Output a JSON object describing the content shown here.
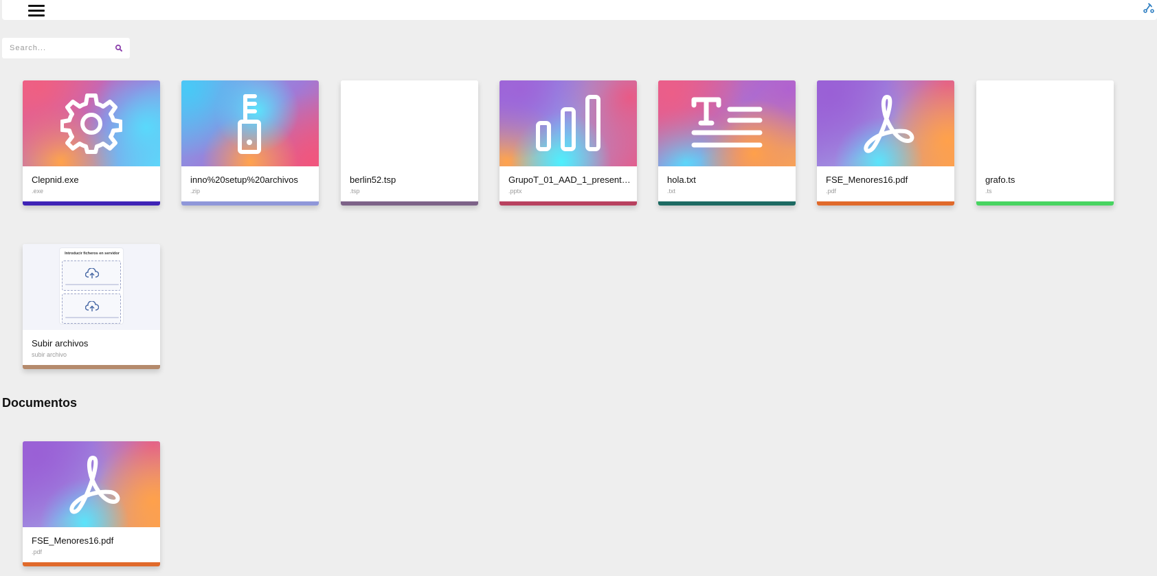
{
  "header": {
    "menu_icon": "hamburger-menu-icon",
    "corner_icon": "graph-tool-icon",
    "corner_icon_color": "#2f7fc2"
  },
  "search": {
    "placeholder": "Search...",
    "value": "",
    "icon": "search-icon",
    "icon_color": "#8e44ad"
  },
  "files": [
    {
      "name": "Clepnid.exe",
      "ext": ".exe",
      "thumb": "gear-icon",
      "stripe": "#3f24b6"
    },
    {
      "name": "inno%20setup%20archivos",
      "ext": ".zip",
      "thumb": "zip-icon",
      "stripe": "#8f97d9"
    },
    {
      "name": "berlin52.tsp",
      "ext": ".tsp",
      "thumb": "blank",
      "stripe": "#7d6288"
    },
    {
      "name": "GrupoT_01_AAD_1_present…",
      "ext": ".pptx",
      "thumb": "bar-chart-icon",
      "stripe": "#b8415f"
    },
    {
      "name": "hola.txt",
      "ext": ".txt",
      "thumb": "text-icon",
      "stripe": "#1d6a62"
    },
    {
      "name": "FSE_Menores16.pdf",
      "ext": ".pdf",
      "thumb": "pdf-icon",
      "stripe": "#e06a2b"
    },
    {
      "name": "grafo.ts",
      "ext": ".ts",
      "thumb": "blank",
      "stripe": "#48d461"
    },
    {
      "name": "Subir archivos",
      "ext": "subir archivo",
      "thumb": "upload-screenshot",
      "stripe": "#b48a6c",
      "preview_title": "Introducir ficheros en servidor"
    }
  ],
  "sections": [
    {
      "title": "Documentos",
      "files": [
        {
          "name": "FSE_Menores16.pdf",
          "ext": ".pdf",
          "thumb": "pdf-icon",
          "stripe": "#e06a2b"
        }
      ]
    }
  ]
}
